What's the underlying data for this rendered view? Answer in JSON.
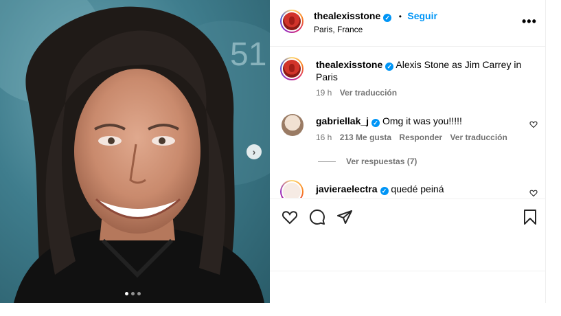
{
  "post": {
    "author": "thealexisstone",
    "follow_label": "Seguir",
    "separator": "•",
    "location": "Paris, France",
    "more_label": "•••"
  },
  "caption": {
    "author": "thealexisstone",
    "text_line1": "Alexis Stone as Jim Carrey in",
    "text_line2": "Paris",
    "time": "19 h",
    "translate_label": "Ver traducción"
  },
  "comments": [
    {
      "author": "gabriellak_j",
      "text": "Omg it was you!!!!!",
      "time": "16 h",
      "likes": "213 Me gusta",
      "reply_label": "Responder",
      "translate_label": "Ver traducción",
      "view_replies_label": "Ver respuestas (7)"
    },
    {
      "author": "javieraelectra",
      "text": "quedé peiná"
    }
  ],
  "carousel": {
    "total": 3,
    "current": 1
  },
  "colors": {
    "link_blue": "#0095f6",
    "verified": "#0095f6",
    "meta_gray": "#737373"
  }
}
